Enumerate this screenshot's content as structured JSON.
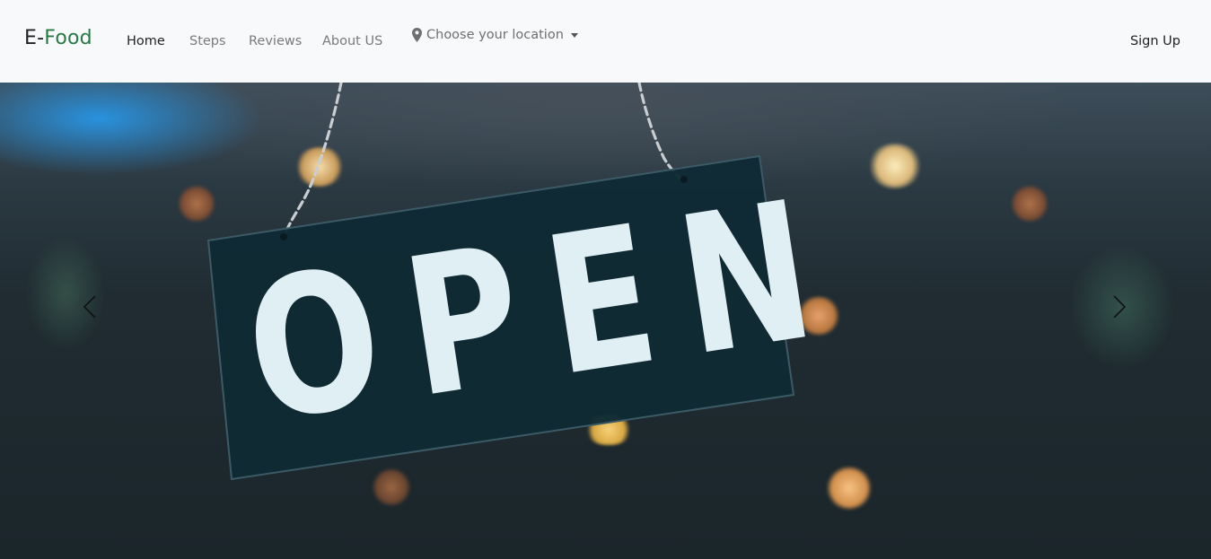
{
  "brand": {
    "part1": "E-",
    "part2": "Food"
  },
  "nav": {
    "home": "Home",
    "steps": "Steps",
    "reviews": "Reviews",
    "about": "About US"
  },
  "location": {
    "label": "Choose your location",
    "icon": "map-marker-icon"
  },
  "signup": "Sign Up",
  "colors": {
    "brand_green": "#267a45",
    "nav_bg": "#f8f9fa"
  },
  "carousel": {
    "sign_text": "OPEN",
    "prev_icon": "chevron-left-icon",
    "next_icon": "chevron-right-icon"
  }
}
